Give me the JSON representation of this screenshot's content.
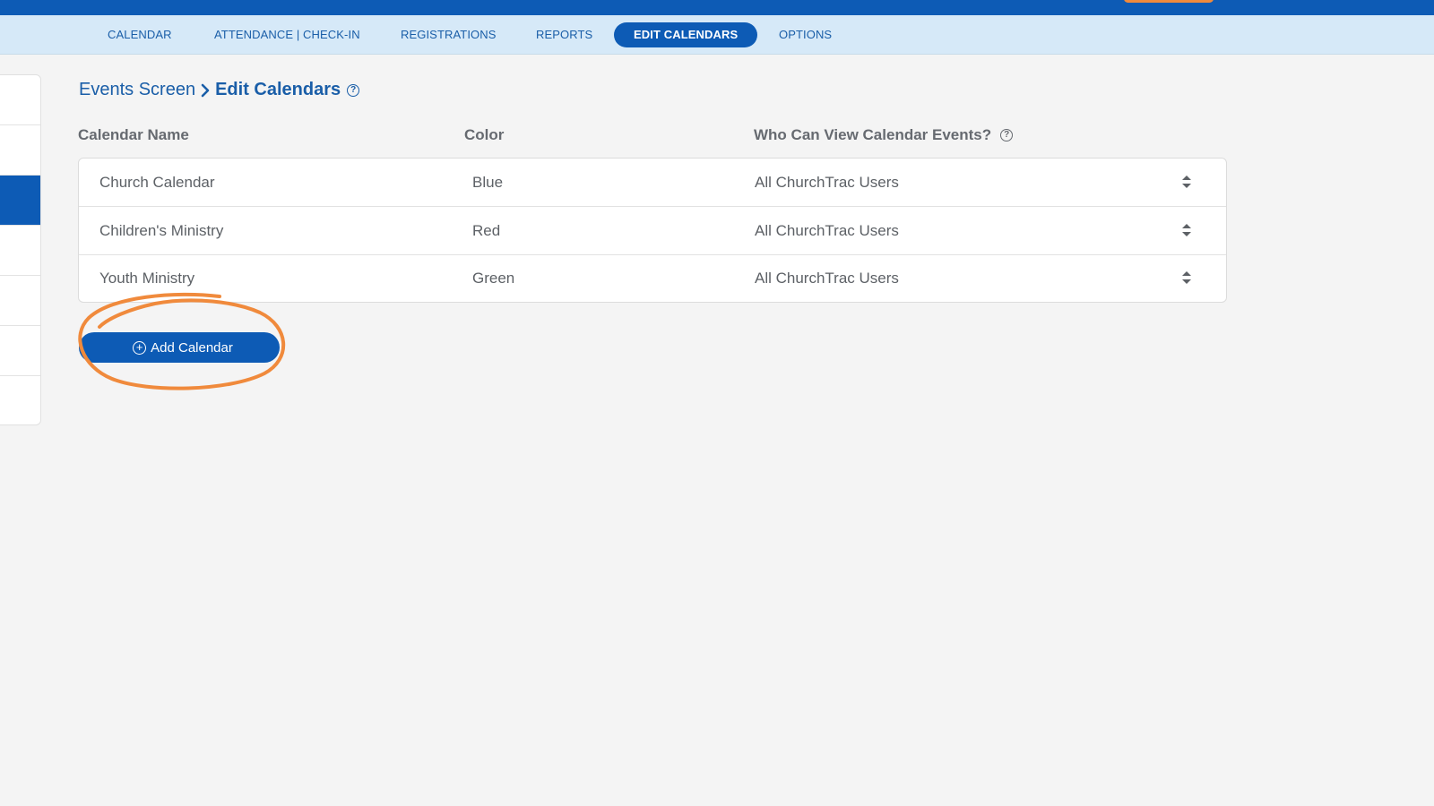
{
  "nav": {
    "items": [
      {
        "label": "CALENDAR",
        "active": false
      },
      {
        "label": "ATTENDANCE | CHECK-IN",
        "active": false
      },
      {
        "label": "REGISTRATIONS",
        "active": false
      },
      {
        "label": "REPORTS",
        "active": false
      },
      {
        "label": "EDIT CALENDARS",
        "active": true
      },
      {
        "label": "OPTIONS",
        "active": false
      }
    ]
  },
  "breadcrumb": {
    "parent": "Events Screen",
    "separator": "›",
    "current": "Edit Calendars",
    "help_glyph": "?"
  },
  "table": {
    "headers": {
      "name": "Calendar Name",
      "color": "Color",
      "visibility": "Who Can View Calendar Events?"
    },
    "help_glyph": "?",
    "rows": [
      {
        "name": "Church Calendar",
        "color": "Blue",
        "visibility": "All ChurchTrac Users"
      },
      {
        "name": "Children's Ministry",
        "color": "Red",
        "visibility": "All ChurchTrac Users"
      },
      {
        "name": "Youth Ministry",
        "color": "Green",
        "visibility": "All ChurchTrac Users"
      }
    ]
  },
  "add_button": {
    "label": "Add Calendar",
    "icon": "plus-circle-icon",
    "icon_glyph": "+"
  },
  "colors": {
    "brand_blue": "#0d5bb5",
    "nav_background": "#d6e9f8",
    "annotation_orange": "#f08a3c",
    "page_background": "#f4f4f4"
  }
}
